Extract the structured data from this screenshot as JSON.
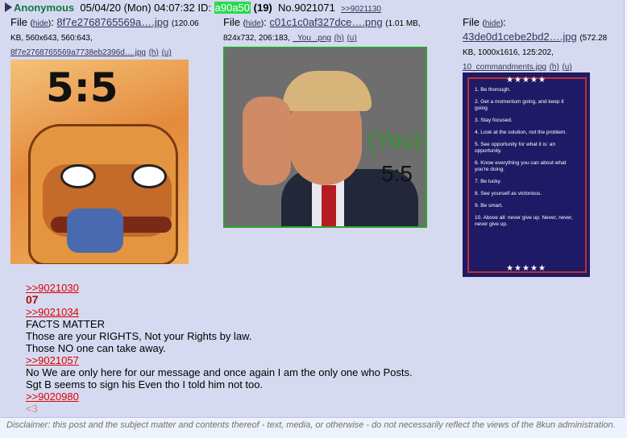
{
  "post": {
    "name": "Anonymous",
    "date": "05/04/20 (Mon) 04:07:32",
    "id_label": "ID:",
    "id_value": "a90a50",
    "id_count": "(19)",
    "number": "No.9021071",
    "reply_link": ">>9021130"
  },
  "files": [
    {
      "label": "File",
      "hide": "hide",
      "name": "8f7e2768765569a….jpg",
      "info_a": "(120.06",
      "info_b": "KB, 560x643, 560:643,",
      "orig": "8f7e2768765569a7738eb2396d….jpg",
      "h": "(h)",
      "u": "(u)"
    },
    {
      "label": "File",
      "hide": "hide",
      "name": "c01c1c0af327dce….png",
      "info_a": "(1.01 MB,",
      "info_b": "824x732, 206:183,",
      "orig": "_You_.png",
      "h": "(h)",
      "u": "(u)",
      "img_you": "(You)",
      "img_fives": "5:5"
    },
    {
      "label": "File",
      "hide": "hide",
      "name": "43de0d1cebe2bd2….jpg",
      "info_a": "(572.28",
      "info_b": "KB, 1000x1616, 125:202,",
      "orig": "10_commandments.jpg",
      "h": "(h)",
      "u": "(u)"
    }
  ],
  "pepe_text": "5:5",
  "commandments": {
    "stars": "★★★★★",
    "items": [
      "1. Be thorough.",
      "2. Get a momentum going, and keep it going.",
      "3. Stay focused.",
      "4. Look at the solution, not the problem.",
      "5. See opportunity for what it is: an opportunity.",
      "6. Know everything you can about what you're doing.",
      "7. Be lucky.",
      "8. See yourself as victorious.",
      "9. Be smart.",
      "10. Above all: never give up. Never, never, never give up."
    ]
  },
  "body": {
    "q1": ">>9021030",
    "bold": "07",
    "q2": ">>9021034",
    "l1": "FACTS MATTER",
    "l2": "Those are your RIGHTS, Not your Rights by law.",
    "l3": "Those NO one can take away.",
    "q3": ">>9021057",
    "l4": "No We are only here for our message and once again I am the only one who Posts.",
    "l5": "Sgt B seems to sign his Even tho I told him not too.",
    "q4": ">>9020980",
    "heart": "<3"
  },
  "disclaimer": "Disclaimer: this post and the subject matter and contents thereof - text, media, or otherwise - do not necessarily reflect the views of the 8kun administration."
}
